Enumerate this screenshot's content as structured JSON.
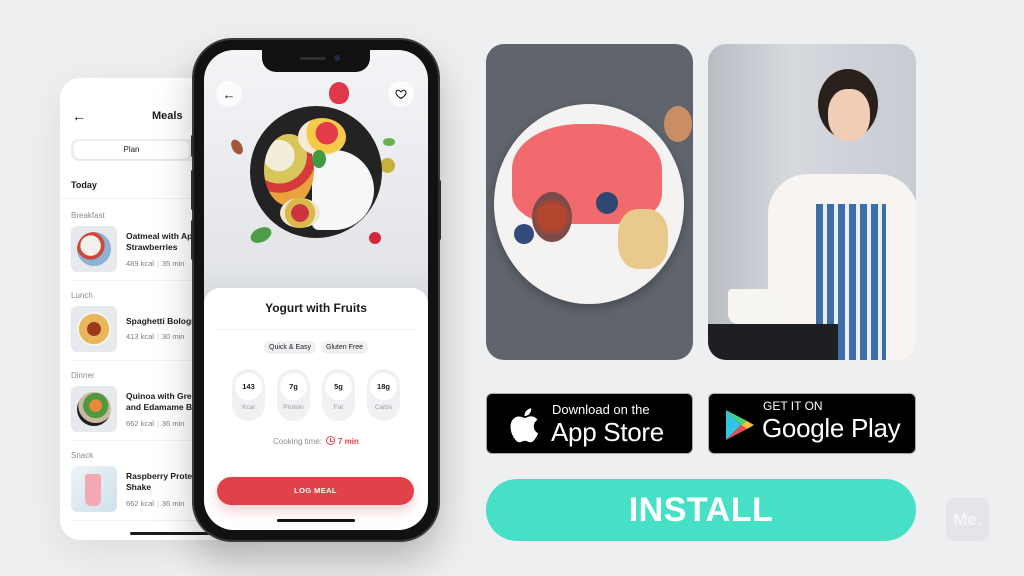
{
  "meals_screen": {
    "title": "Meals",
    "back_icon": "arrow-left-icon",
    "segment_active": "Plan",
    "today_label": "Today",
    "sections": [
      {
        "label": "Breakfast",
        "name": "Oatmeal with Apple\nStrawberries",
        "kcal": "489 kcal",
        "time": "35 min"
      },
      {
        "label": "Lunch",
        "name": "Spaghetti Bolognese",
        "kcal": "413 kcal",
        "time": "30 min"
      },
      {
        "label": "Dinner",
        "name": "Quinoa with Greens\nand Edamame Bowl",
        "kcal": "662 kcal",
        "time": "36 min"
      },
      {
        "label": "Snack",
        "name": "Raspberry Protein\nShake",
        "kcal": "662 kcal",
        "time": "36 min"
      }
    ]
  },
  "detail_screen": {
    "back_icon": "arrow-left-icon",
    "favorite_icon": "heart-icon",
    "dish_title": "Yogurt with Fruits",
    "tags": [
      "Quick & Easy",
      "Gluten Free"
    ],
    "nutrition": [
      {
        "value": "143",
        "label": "Kcal"
      },
      {
        "value": "7g",
        "label": "Protein"
      },
      {
        "value": "5g",
        "label": "Fat"
      },
      {
        "value": "18g",
        "label": "Carbs"
      }
    ],
    "cooking_label": "Cooking time:",
    "cooking_value": "7 min",
    "log_button": "LOG MEAL"
  },
  "photos": [
    {
      "alt": "Bowl of yogurt with grapefruit, figs, blueberries and granola"
    },
    {
      "alt": "Woman in striped apron cooking at stove"
    }
  ],
  "stores": {
    "apple": {
      "small": "Download on the",
      "big": "App Store",
      "icon": "apple-icon"
    },
    "google": {
      "small": "GET IT ON",
      "big": "Google Play",
      "icon": "google-play-icon"
    }
  },
  "install_label": "INSTALL",
  "brand_logo": "Me.",
  "colors": {
    "accent_red": "#e1424a",
    "install_teal": "#45e0c6",
    "background": "#eeeff1"
  }
}
